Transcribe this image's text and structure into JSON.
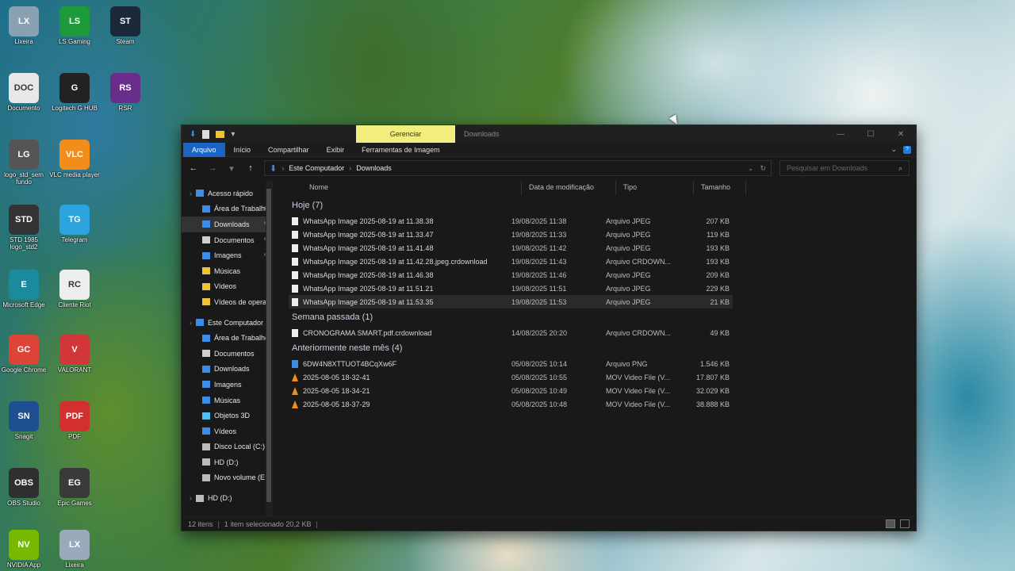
{
  "desktop": {
    "icons": [
      {
        "label": "Lixeira",
        "glyph": "LX",
        "color": "#8aa0b3"
      },
      {
        "label": "LS Gaming",
        "glyph": "LS",
        "color": "#1d9b3a"
      },
      {
        "label": "Steam",
        "glyph": "ST",
        "color": "#1b2838"
      },
      {
        "label": "Documento",
        "glyph": "DOC",
        "color": "#e8e8e8"
      },
      {
        "label": "Logitech G HUB",
        "glyph": "G",
        "color": "#222"
      },
      {
        "label": "RSR",
        "glyph": "RS",
        "color": "#6b2d8c"
      },
      {
        "label": "logo_std_sem fundo",
        "glyph": "LG",
        "color": "#555"
      },
      {
        "label": "VLC media player",
        "glyph": "VLC",
        "color": "#f28c1a"
      },
      {
        "label": "STD 1985 logo_std2",
        "glyph": "STD",
        "color": "#333"
      },
      {
        "label": "Telegram",
        "glyph": "TG",
        "color": "#2aa3df"
      },
      {
        "label": "Microsoft Edge",
        "glyph": "E",
        "color": "#1a8a9c"
      },
      {
        "label": "Cliente Riot",
        "glyph": "RC",
        "color": "#eeeeee"
      },
      {
        "label": "Google Chrome",
        "glyph": "GC",
        "color": "#db4437"
      },
      {
        "label": "VALORANT",
        "glyph": "V",
        "color": "#d13639"
      },
      {
        "label": "Snagit",
        "glyph": "SN",
        "color": "#1d4f91"
      },
      {
        "label": "PDF",
        "glyph": "PDF",
        "color": "#d32f2f"
      },
      {
        "label": "OBS Studio",
        "glyph": "OBS",
        "color": "#302e31"
      },
      {
        "label": "Epic Games",
        "glyph": "EG",
        "color": "#3a3a3a"
      },
      {
        "label": "NVIDIA App",
        "glyph": "NV",
        "color": "#76b900"
      },
      {
        "label": "Lixeira",
        "glyph": "LX",
        "color": "#9aaabb"
      }
    ]
  },
  "window": {
    "contextual_tab": "Gerenciar",
    "title": "Downloads",
    "ribbon_tabs": [
      "Arquivo",
      "Início",
      "Compartilhar",
      "Exibir",
      "Ferramentas de Imagem"
    ],
    "address": {
      "root": "Este Computador",
      "current": "Downloads"
    },
    "search_placeholder": "Pesquisar em Downloads",
    "nav_items": [
      {
        "label": "Acesso rápido",
        "level": 0,
        "icon": "star-icon",
        "color": "#3a8ee6",
        "pinned": false
      },
      {
        "label": "Área de Trabalho",
        "level": 1,
        "icon": "desktop-folder-icon",
        "color": "#3a8ee6",
        "pinned": true
      },
      {
        "label": "Downloads",
        "level": 1,
        "icon": "download-folder-icon",
        "color": "#3a8ee6",
        "pinned": true,
        "selected": true
      },
      {
        "label": "Documentos",
        "level": 1,
        "icon": "documents-folder-icon",
        "color": "#cfcfcf",
        "pinned": true
      },
      {
        "label": "Imagens",
        "level": 1,
        "icon": "pictures-folder-icon",
        "color": "#3a8ee6",
        "pinned": true
      },
      {
        "label": "Músicas",
        "level": 1,
        "icon": "music-folder-icon",
        "color": "#f0c23a",
        "pinned": false
      },
      {
        "label": "Vídeos",
        "level": 1,
        "icon": "videos-folder-icon",
        "color": "#f0c23a",
        "pinned": false
      },
      {
        "label": "Vídeos de operação",
        "level": 1,
        "icon": "folder-icon",
        "color": "#f0c23a",
        "pinned": false
      },
      {
        "label": "Este Computador",
        "level": 0,
        "icon": "computer-icon",
        "color": "#3a8ee6",
        "pinned": false,
        "gap": true
      },
      {
        "label": "Área de Trabalho",
        "level": 1,
        "icon": "desktop-folder-icon",
        "color": "#3a8ee6",
        "pinned": false
      },
      {
        "label": "Documentos",
        "level": 1,
        "icon": "documents-folder-icon",
        "color": "#cfcfcf",
        "pinned": false
      },
      {
        "label": "Downloads",
        "level": 1,
        "icon": "download-folder-icon",
        "color": "#3a8ee6",
        "pinned": false
      },
      {
        "label": "Imagens",
        "level": 1,
        "icon": "pictures-folder-icon",
        "color": "#3a8ee6",
        "pinned": false
      },
      {
        "label": "Músicas",
        "level": 1,
        "icon": "music-folder-icon",
        "color": "#3a8ee6",
        "pinned": false
      },
      {
        "label": "Objetos 3D",
        "level": 1,
        "icon": "objects3d-folder-icon",
        "color": "#4cc2f0",
        "pinned": false
      },
      {
        "label": "Vídeos",
        "level": 1,
        "icon": "videos-folder-icon",
        "color": "#3a8ee6",
        "pinned": false
      },
      {
        "label": "Disco Local (C:)",
        "level": 1,
        "icon": "drive-icon",
        "color": "#bbbbbb",
        "pinned": false
      },
      {
        "label": "HD (D:)",
        "level": 1,
        "icon": "drive-icon",
        "color": "#bbbbbb",
        "pinned": false
      },
      {
        "label": "Novo volume (E:)",
        "level": 1,
        "icon": "drive-icon",
        "color": "#bbbbbb",
        "pinned": false
      },
      {
        "label": "HD (D:)",
        "level": 0,
        "icon": "drive-icon",
        "color": "#bbbbbb",
        "pinned": false,
        "gap": true
      }
    ],
    "columns": {
      "name": "Nome",
      "date": "Data de modificação",
      "type": "Tipo",
      "size": "Tamanho"
    },
    "groups": [
      {
        "title": "Hoje (7)",
        "files": [
          {
            "name": "WhatsApp Image 2025-08-19 at 11.38.38",
            "date": "19/08/2025 11:38",
            "type": "Arquivo JPEG",
            "size": "207 KB",
            "kind": "image"
          },
          {
            "name": "WhatsApp Image 2025-08-19 at 11.33.47",
            "date": "19/08/2025 11:33",
            "type": "Arquivo JPEG",
            "size": "119 KB",
            "kind": "image"
          },
          {
            "name": "WhatsApp Image 2025-08-19 at 11.41.48",
            "date": "19/08/2025 11:42",
            "type": "Arquivo JPEG",
            "size": "193 KB",
            "kind": "image"
          },
          {
            "name": "WhatsApp Image 2025-08-19 at 11.42.28.jpeg.crdownload",
            "date": "19/08/2025 11:43",
            "type": "Arquivo CRDOWN...",
            "size": "193 KB",
            "kind": "file"
          },
          {
            "name": "WhatsApp Image 2025-08-19 at 11.46.38",
            "date": "19/08/2025 11:46",
            "type": "Arquivo JPEG",
            "size": "209 KB",
            "kind": "image"
          },
          {
            "name": "WhatsApp Image 2025-08-19 at 11.51.21",
            "date": "19/08/2025 11:51",
            "type": "Arquivo JPEG",
            "size": "229 KB",
            "kind": "image"
          },
          {
            "name": "WhatsApp Image 2025-08-19 at 11.53.35",
            "date": "19/08/2025 11:53",
            "type": "Arquivo JPEG",
            "size": "21 KB",
            "kind": "image",
            "selected": true
          }
        ]
      },
      {
        "title": "Semana passada (1)",
        "files": [
          {
            "name": "CRONOGRAMA SMART.pdf.crdownload",
            "date": "14/08/2025 20:20",
            "type": "Arquivo CRDOWN...",
            "size": "49 KB",
            "kind": "file"
          }
        ]
      },
      {
        "title": "Anteriormente neste mês (4)",
        "files": [
          {
            "name": "6DW4N8XTTUOT4BCqXw6F",
            "date": "05/08/2025 10:14",
            "type": "Arquivo PNG",
            "size": "1.546 KB",
            "kind": "png"
          },
          {
            "name": "2025-08-05 18-32-41",
            "date": "05/08/2025 10:55",
            "type": "MOV Video File (V...",
            "size": "17.807 KB",
            "kind": "video"
          },
          {
            "name": "2025-08-05 18-34-21",
            "date": "05/08/2025 10:49",
            "type": "MOV Video File (V...",
            "size": "32.029 KB",
            "kind": "video"
          },
          {
            "name": "2025-08-05 18-37-29",
            "date": "05/08/2025 10:48",
            "type": "MOV Video File (V...",
            "size": "38.888 KB",
            "kind": "video"
          }
        ]
      }
    ],
    "status": {
      "items": "12 itens",
      "selection": "1 item selecionado  20,2 KB"
    }
  }
}
